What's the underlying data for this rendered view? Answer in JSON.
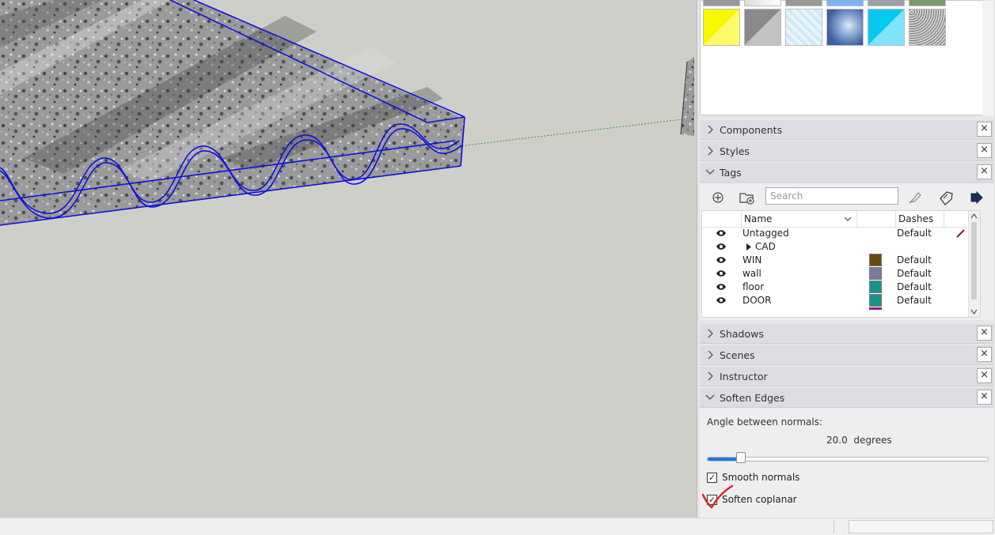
{
  "panels": {
    "components": "Components",
    "styles": "Styles",
    "tags": "Tags",
    "shadows": "Shadows",
    "scenes": "Scenes",
    "instructor": "Instructor",
    "soften_edges": "Soften Edges",
    "close_glyph": "×"
  },
  "tags": {
    "search_placeholder": "Search",
    "columns": {
      "name": "Name",
      "dashes": "Dashes"
    },
    "rows": [
      {
        "name": "Untagged",
        "color": "",
        "dashes": "Default"
      },
      {
        "name": "CAD",
        "color": "",
        "dashes": ""
      },
      {
        "name": "WIN",
        "color": "#6b4a10",
        "dashes": "Default"
      },
      {
        "name": "wall",
        "color": "#7b7a9c",
        "dashes": "Default"
      },
      {
        "name": "floor",
        "color": "#179488",
        "dashes": "Default"
      },
      {
        "name": "DOOR",
        "color": "#179488",
        "dashes": "Default"
      }
    ]
  },
  "soften": {
    "angle_label": "Angle between normals:",
    "angle_value": "20.0",
    "angle_unit": "degrees",
    "slider_fraction": 0.12,
    "smooth_normals_label": "Smooth normals",
    "smooth_normals_checked": true,
    "soften_coplanar_label": "Soften coplanar",
    "soften_coplanar_checked": true
  },
  "colors": {
    "selection_blue": "#1010e0",
    "viewport_bg": "#cfcfca",
    "slider_fill": "#1f7bd6",
    "annotation_red": "#e02020"
  }
}
